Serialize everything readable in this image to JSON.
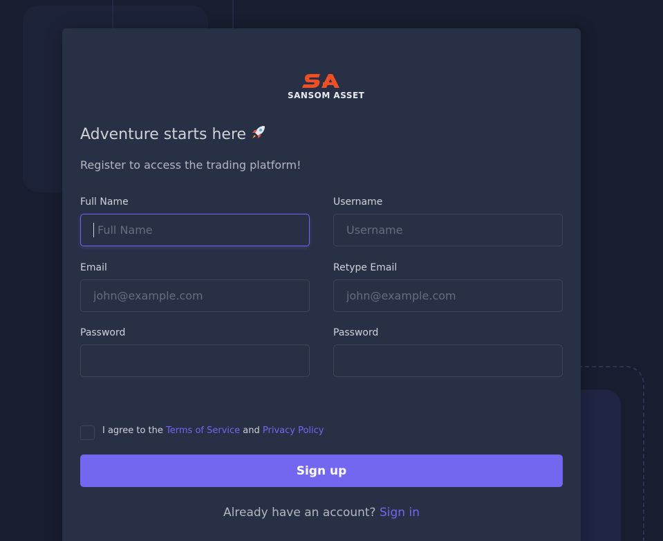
{
  "brand": {
    "name": "SANSOM ASSET",
    "logo_color": "#f04e23"
  },
  "heading": {
    "title": "Adventure starts here",
    "emoji": "rocket-icon",
    "subtitle": "Register to access the trading platform!"
  },
  "form": {
    "full_name": {
      "label": "Full Name",
      "placeholder": "Full Name",
      "value": ""
    },
    "username": {
      "label": "Username",
      "placeholder": "Username",
      "value": ""
    },
    "email": {
      "label": "Email",
      "placeholder": "john@example.com",
      "value": ""
    },
    "retype_email": {
      "label": "Retype Email",
      "placeholder": "john@example.com",
      "value": ""
    },
    "password": {
      "label": "Password",
      "placeholder": "",
      "value": ""
    },
    "confirm_password": {
      "label": "Password",
      "placeholder": "",
      "value": ""
    }
  },
  "agreement": {
    "checked": false,
    "prefix": "I agree to the",
    "terms_link": "Terms of Service",
    "conjunction": "and",
    "privacy_link": "Privacy Policy"
  },
  "actions": {
    "signup_label": "Sign up"
  },
  "footer": {
    "prompt": "Already have an account?",
    "signin_link": "Sign in"
  },
  "colors": {
    "accent": "#7367f0",
    "card_bg": "#283046",
    "page_bg": "#171c2e"
  }
}
